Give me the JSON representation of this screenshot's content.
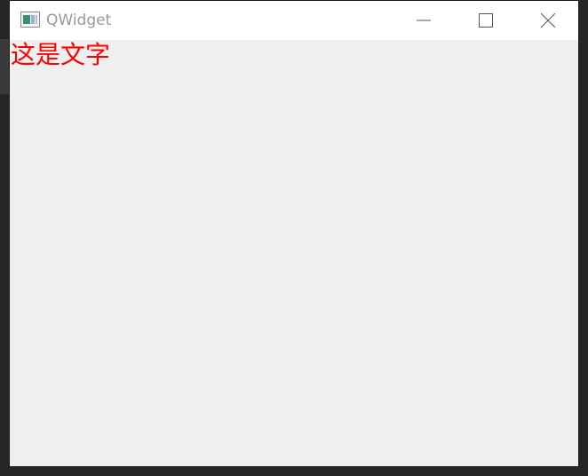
{
  "window": {
    "title": "QWidget",
    "icon": "qt-app-window-icon",
    "controls": {
      "minimize": "minimize-icon",
      "maximize": "maximize-icon",
      "close": "close-icon"
    }
  },
  "content": {
    "label_text": "这是文字",
    "label_color": "#ff0000",
    "background": "#efefef"
  }
}
